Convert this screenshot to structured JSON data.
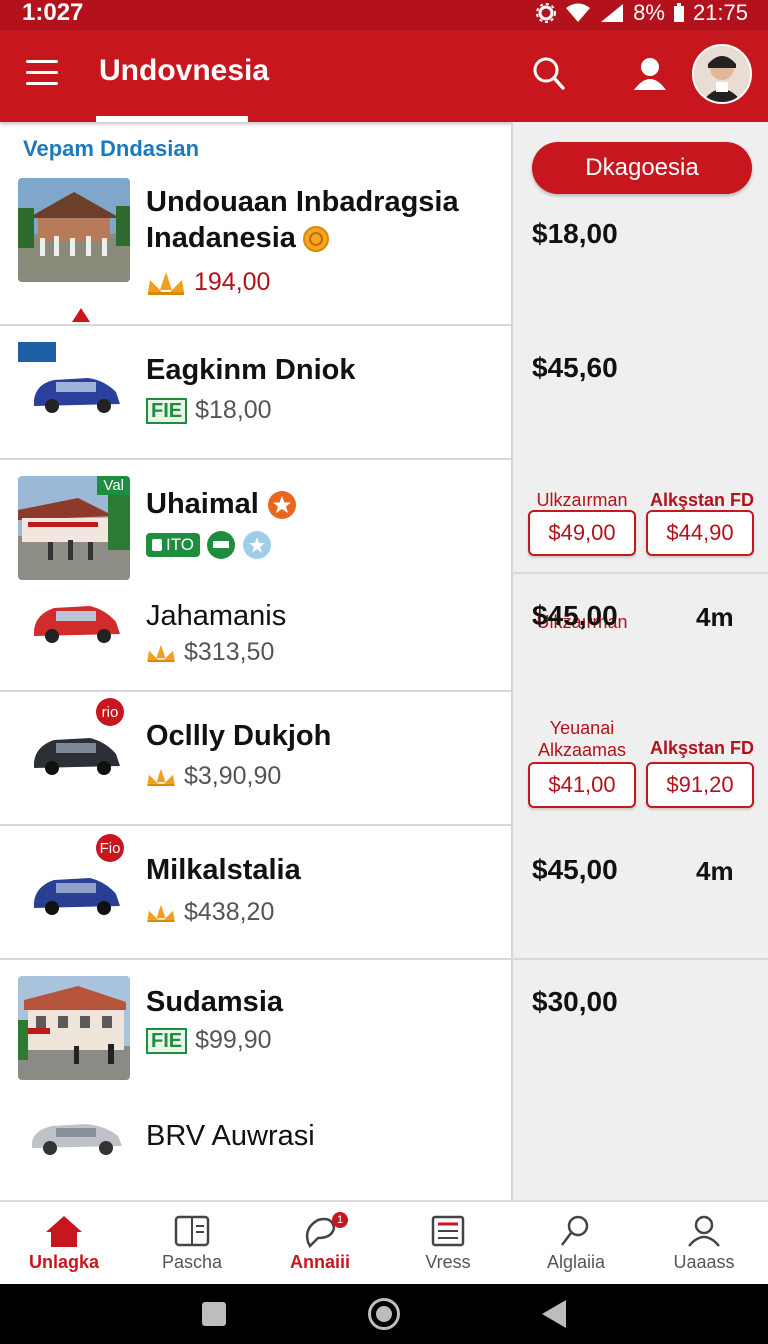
{
  "status_bar": {
    "time": "1:027",
    "battery": "8%",
    "clock": "21:75"
  },
  "app_bar": {
    "title": "Undovnesia"
  },
  "section_label": "Vepam Dndasian",
  "primary_button": "Dkagoesia",
  "items": [
    {
      "name_line1": "Undouaan Inbadragsia",
      "name_line2": "Inadanesia",
      "rating": "194,00",
      "price": "$18,00"
    },
    {
      "name": "Eagkinm Dniok",
      "tag": "FIE",
      "sub_price": "$18,00",
      "price": "$45,60",
      "thumb_label": ""
    },
    {
      "name": "Uhaimal",
      "thumb_label": "Val",
      "tag": "ITO",
      "deal_a_label": "Ulkzaırman",
      "deal_a_price": "$49,00",
      "deal_b_label": "Alkşstan FD",
      "deal_b_price": "$44,90"
    },
    {
      "name": "Jahamanis",
      "sub_price": "$313,50",
      "price": "$45,00",
      "distance": "4m"
    },
    {
      "name": "Ocllly Dukjoh",
      "badge": "rio",
      "sub_price": "$3,90,90",
      "deal_a_label_1": "Yeuanai",
      "deal_a_label_2": "Alkzaamas",
      "deal_a_price": "$41,00",
      "deal_b_label": "Alkşstan FD",
      "deal_b_price": "$91,20"
    },
    {
      "name": "Milkalstalia",
      "badge": "Fio",
      "sub_price": "$438,20",
      "price": "$45,00",
      "distance": "4m"
    },
    {
      "name": "Sudamsia",
      "tag": "FIE",
      "sub_price": "$99,90",
      "price": "$30,00"
    },
    {
      "name": "BRV Auwrasi"
    }
  ],
  "bottom_nav": [
    {
      "label": "Unlagka",
      "icon": "home-icon"
    },
    {
      "label": "Pascha",
      "icon": "document-icon"
    },
    {
      "label": "Annaiii",
      "icon": "chat-icon",
      "badge": "1"
    },
    {
      "label": "Vress",
      "icon": "list-icon"
    },
    {
      "label": "Alglaiia",
      "icon": "pin-icon"
    },
    {
      "label": "Uaaass",
      "icon": "user-icon"
    }
  ],
  "colors": {
    "brand_red": "#c8161f",
    "link_blue": "#1a7abf",
    "green_tag": "#1e8e3e"
  }
}
